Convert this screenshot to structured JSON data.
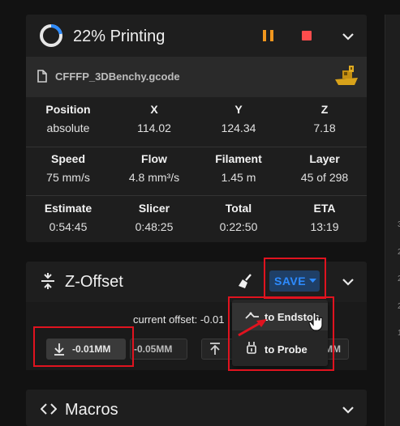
{
  "print_status": {
    "title": "22% Printing",
    "progress_percent": 22,
    "file_name": "CFFFP_3DBenchy.gcode"
  },
  "stats": [
    {
      "label": "Position",
      "value": "absolute"
    },
    {
      "label": "X",
      "value": "114.02"
    },
    {
      "label": "Y",
      "value": "124.34"
    },
    {
      "label": "Z",
      "value": "7.18"
    },
    {
      "label": "Speed",
      "value": "75 mm/s"
    },
    {
      "label": "Flow",
      "value": "4.8 mm³/s"
    },
    {
      "label": "Filament",
      "value": "1.45 m"
    },
    {
      "label": "Layer",
      "value": "45 of 298"
    },
    {
      "label": "Estimate",
      "value": "0:54:45"
    },
    {
      "label": "Slicer",
      "value": "0:48:25"
    },
    {
      "label": "Total",
      "value": "0:22:50"
    },
    {
      "label": "ETA",
      "value": "13:19"
    }
  ],
  "zoffset": {
    "title": "Z-Offset",
    "save_label": "SAVE",
    "current_offset_text": "current offset: -0.01",
    "button_down_001": "-0.01MM",
    "button_down_005": "-0.05MM",
    "button_up_partial": "MM",
    "menu": {
      "endstop_label": "to Endstop",
      "probe_label": "to Probe"
    }
  },
  "macros": {
    "title": "Macros"
  },
  "right_panel_numbers": [
    "3",
    "2",
    "2",
    "2",
    "1"
  ],
  "colors": {
    "accent_blue": "#2d8bff",
    "pause_orange": "#f0961e",
    "stop_red": "#ff4d4d",
    "highlight_red": "#e0131f",
    "benchy_gold": "#d8a21a"
  }
}
